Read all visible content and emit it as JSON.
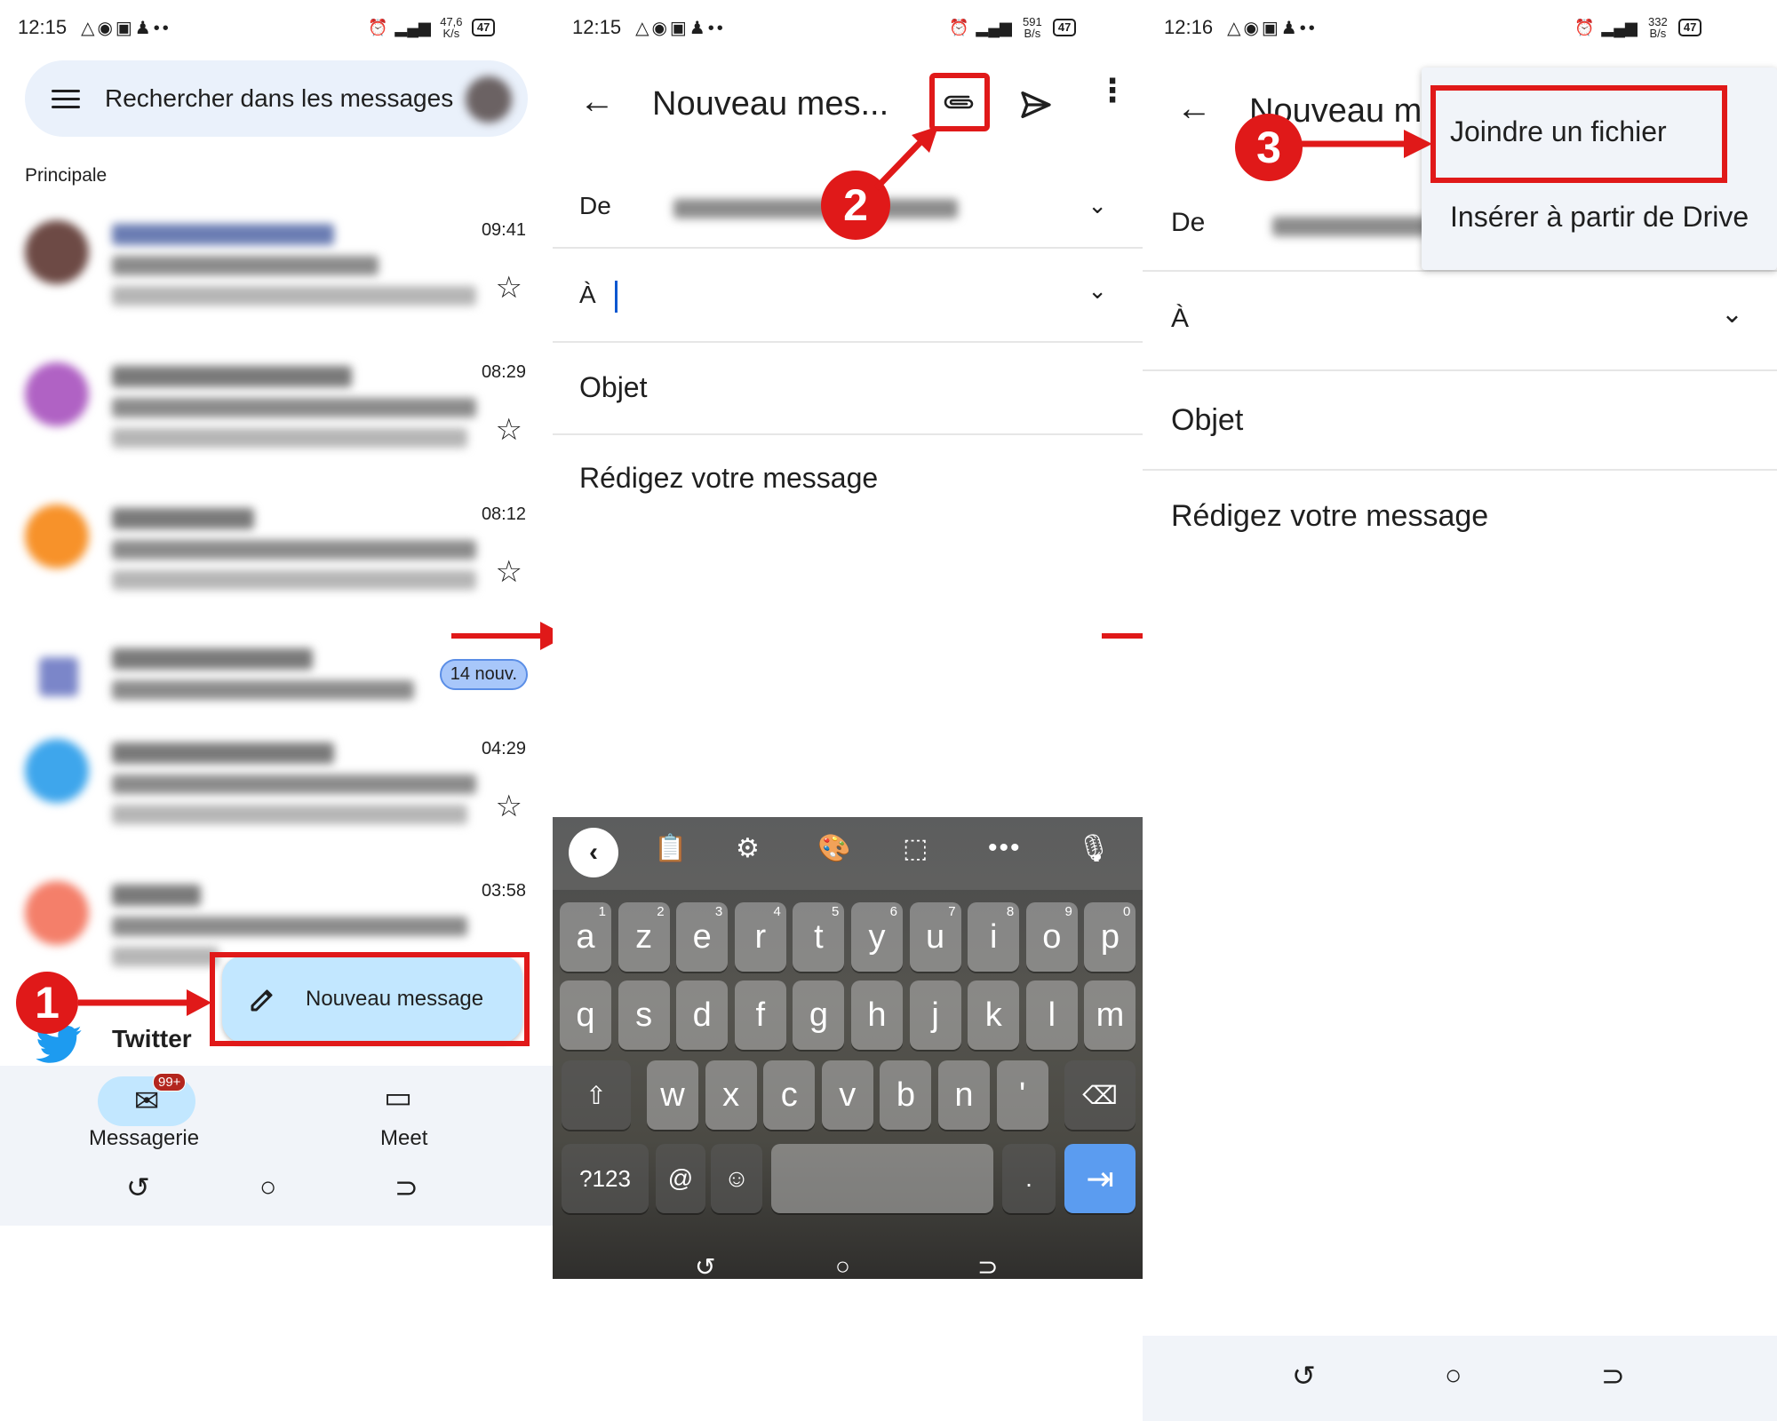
{
  "panel1": {
    "status": {
      "time": "12:15",
      "speed": "47,6 K/s",
      "battery": "47"
    },
    "search_placeholder": "Rechercher dans les messages",
    "section": "Principale",
    "mails": [
      {
        "time": "09:41"
      },
      {
        "time": "08:29"
      },
      {
        "time": "08:12"
      },
      {
        "badge": "14 nouv."
      },
      {
        "time": "04:29"
      },
      {
        "time": "03:58"
      }
    ],
    "twitter_sender": "Twitter",
    "fab_label": "Nouveau message",
    "nav": {
      "mail_label": "Messagerie",
      "mail_badge": "99+",
      "meet_label": "Meet"
    },
    "step": "1"
  },
  "panel2": {
    "status": {
      "time": "12:15",
      "speed": "591 B/s",
      "battery": "47"
    },
    "title": "Nouveau mes...",
    "from_label": "De",
    "to_label": "À",
    "subject_placeholder": "Objet",
    "body_placeholder": "Rédigez votre message",
    "step": "2",
    "keyboard": {
      "row1": [
        [
          "a",
          "1"
        ],
        [
          "z",
          "2"
        ],
        [
          "e",
          "3"
        ],
        [
          "r",
          "4"
        ],
        [
          "t",
          "5"
        ],
        [
          "y",
          "6"
        ],
        [
          "u",
          "7"
        ],
        [
          "i",
          "8"
        ],
        [
          "o",
          "9"
        ],
        [
          "p",
          "0"
        ]
      ],
      "row2": [
        "q",
        "s",
        "d",
        "f",
        "g",
        "h",
        "j",
        "k",
        "l",
        "m"
      ],
      "row3": [
        "w",
        "x",
        "c",
        "v",
        "b",
        "n",
        "'"
      ],
      "symbols_key": "?123",
      "at_key": "@",
      "period_key": "."
    }
  },
  "panel3": {
    "status": {
      "time": "12:16",
      "speed": "332 B/s",
      "battery": "47"
    },
    "title": "Nouveau m",
    "from_label": "De",
    "to_label": "À",
    "subject_placeholder": "Objet",
    "body_placeholder": "Rédigez votre message",
    "menu": {
      "attach": "Joindre un fichier",
      "drive": "Insérer à partir de Drive"
    },
    "step": "3"
  },
  "colors": {
    "annotation_red": "#e01919",
    "fab_bg": "#c2e7ff",
    "search_bg": "#eaf1fb",
    "enter_key": "#5b9cf0"
  }
}
